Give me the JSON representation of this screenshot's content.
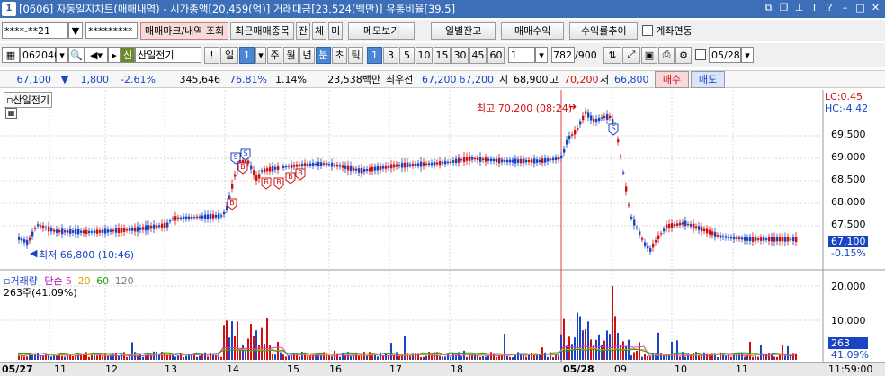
{
  "window": {
    "title": "[0606] 자동일지차트(매매내역) - 시가총액[20,459(억)] 거래대금[23,524(백만)] 유통비율[39.5]",
    "app_icon": "1"
  },
  "toolbar1": {
    "account": "****-**21",
    "password": "*********",
    "buttons": [
      "매매마크/내역 조회",
      "최근매매종목",
      "잔",
      "체",
      "미",
      "메모보기",
      "일별잔고",
      "매매수익",
      "수익률추이"
    ],
    "checkbox_label": "계좌연동"
  },
  "toolbar2": {
    "code": "062040",
    "market_badge": "신",
    "stock_name": "산일전기",
    "period_buttons": [
      "일",
      "1",
      "주",
      "월",
      "년",
      "분",
      "초",
      "틱"
    ],
    "interval_buttons": [
      "1",
      "3",
      "5",
      "10",
      "15",
      "30",
      "45",
      "60"
    ],
    "interval_value": "1",
    "count": "782",
    "count_total": "/900",
    "date": "05/28"
  },
  "quote": {
    "price": "67,100",
    "arrow": "▼",
    "change": "1,800",
    "change_pct": "-2.61%",
    "volume": "345,646",
    "rate1": "76.81%",
    "rate2": "1.14%",
    "amount": "23,538백만",
    "best_ask_label": "최우선",
    "best_ask": "67,200",
    "best_bid": "67,200",
    "open_label": "시",
    "open": "68,900",
    "high_label": "고",
    "high": "70,200",
    "low_label": "저",
    "low": "66,800",
    "buy_label": "매수",
    "sell_label": "매도"
  },
  "price_panel": {
    "name": "산일전기",
    "lc": "LC:0.45",
    "hc": "HC:-4.42",
    "high_note": "최고 70,200 (08:24)",
    "low_note": "최저 66,800 (10:46)",
    "y_ticks": [
      "69,500",
      "69,000",
      "68,500",
      "68,000",
      "67,500"
    ],
    "current_price": "67,100",
    "current_pct": "-0.15%"
  },
  "volume_panel": {
    "title": "거래량",
    "ma_label": "단순",
    "ma_periods": [
      "5",
      "20",
      "60",
      "120"
    ],
    "info": "263주(41.09%)",
    "y_ticks": [
      "20,000",
      "10,000"
    ],
    "current": "263",
    "current_pct": "41.09%"
  },
  "x_axis": {
    "labels": [
      "05/27",
      "11",
      "12",
      "13",
      "14",
      "15",
      "16",
      "17",
      "18",
      "05/28",
      "09",
      "10",
      "11"
    ],
    "time": "11:59:00"
  },
  "colors": {
    "title_bg": "#3c6fb8",
    "up": "#d01010",
    "down": "#1a44c4",
    "bg": "#ffffff"
  }
}
